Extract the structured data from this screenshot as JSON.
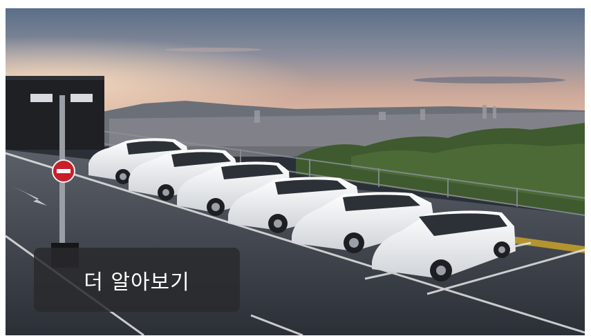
{
  "banner": {
    "image_alt": "",
    "cta_label": "더 알아보기"
  },
  "colors": {
    "sky_top": "#5d7189",
    "sky_glow": "#e8c4a8",
    "asphalt": "#3b4048",
    "car_white": "#eef0f2",
    "cta_bg": "#2a2a2c",
    "sign_red": "#c8202a"
  }
}
